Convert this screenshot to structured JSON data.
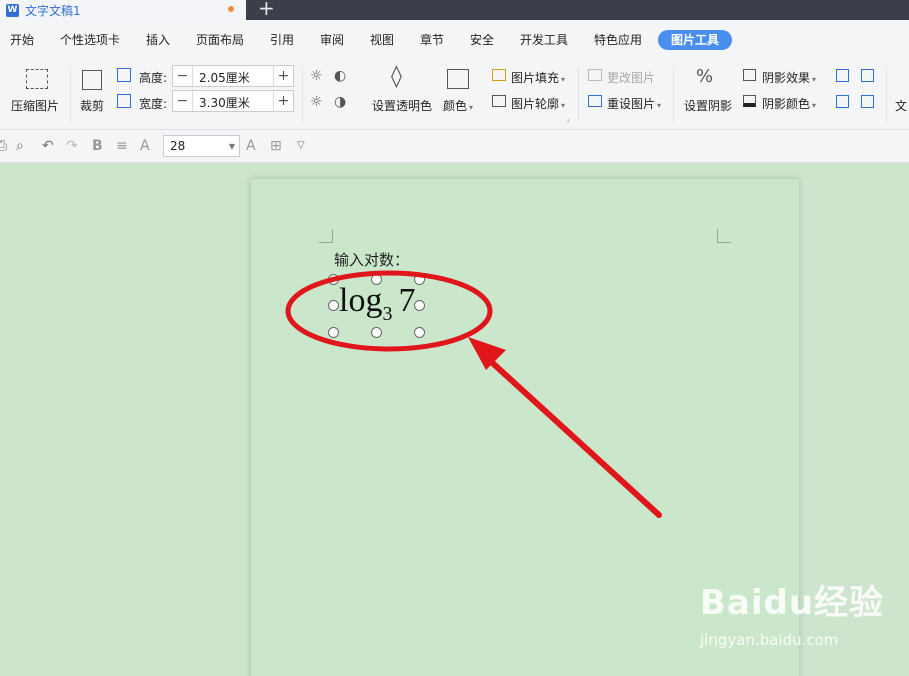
{
  "titlebar": {
    "doc_name": "文字文稿1",
    "new_tab": "+"
  },
  "menu": {
    "items": [
      "开始",
      "个性选项卡",
      "插入",
      "页面布局",
      "引用",
      "审阅",
      "视图",
      "章节",
      "安全",
      "开发工具",
      "特色应用"
    ],
    "active": "图片工具"
  },
  "ribbon": {
    "compress": "压缩图片",
    "crop": "裁剪",
    "height_label": "高度:",
    "height_value": "2.05厘米",
    "width_label": "宽度:",
    "width_value": "3.30厘米",
    "transparent": "设置透明色",
    "color": "颜色",
    "fill": "图片填充",
    "outline": "图片轮廓",
    "change_picture": "更改图片",
    "reset_picture": "重设图片",
    "shadow_set": "设置阴影",
    "shadow_effect": "阴影效果",
    "shadow_color": "阴影颜色",
    "text_cut": "文"
  },
  "quickbar": {
    "font_size": "28"
  },
  "document": {
    "paragraph": "输入对数：",
    "formula_base": "log",
    "formula_sub": "3",
    "formula_arg": "7"
  },
  "watermark": {
    "brand": "Baidu经验",
    "url": "jingyan.baidu.com"
  },
  "colors": {
    "accent": "#4a8ff0",
    "annotation": "#e0161b",
    "page": "#cbe7cb"
  }
}
